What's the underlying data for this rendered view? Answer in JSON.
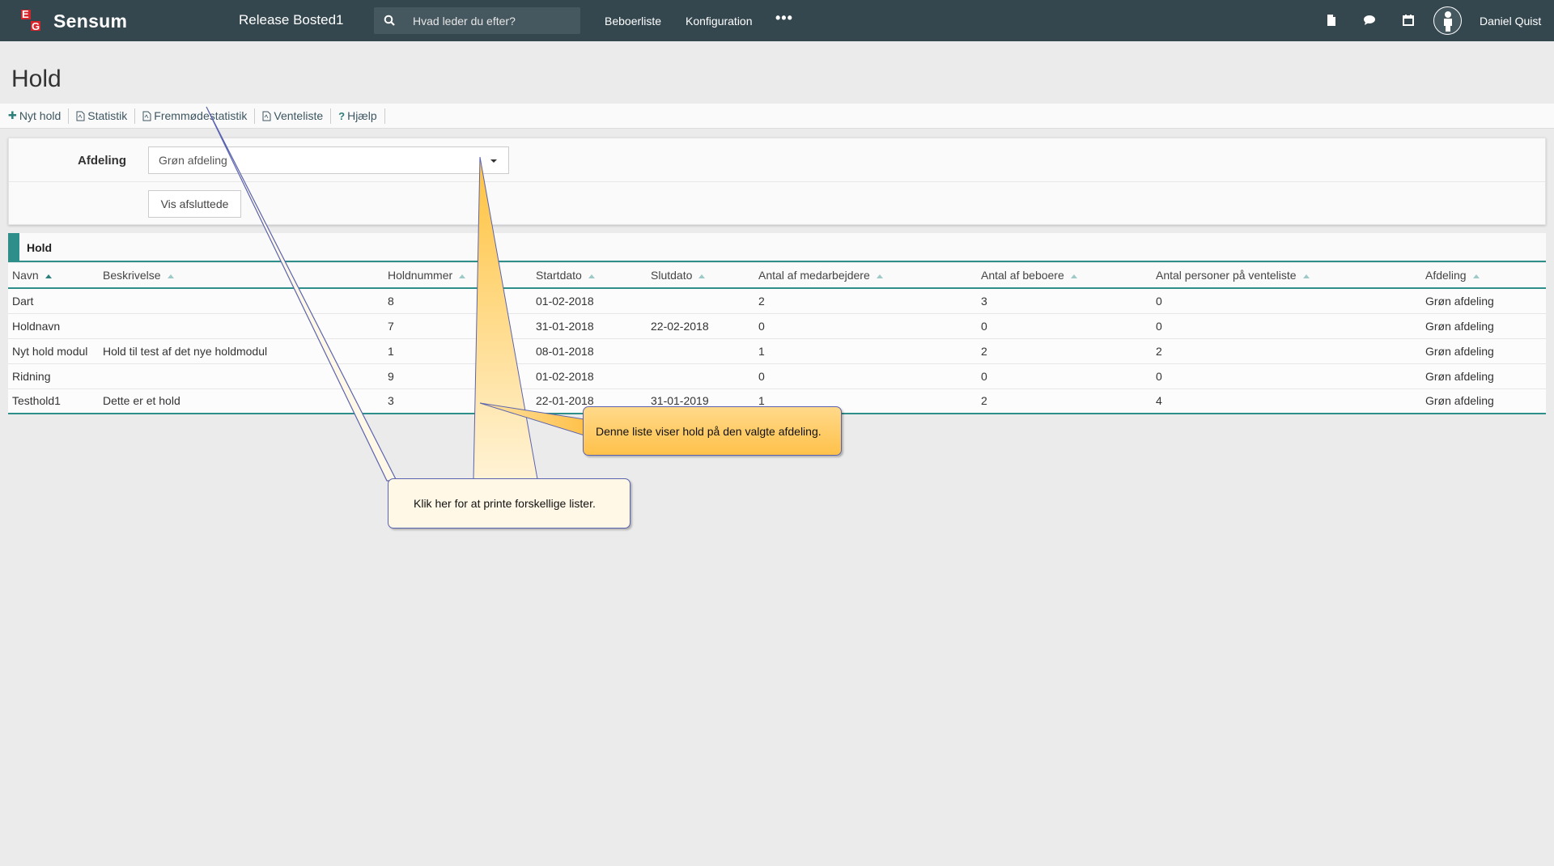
{
  "navbar": {
    "brand_logo_letters": "EG",
    "brand_name": "Sensum",
    "app_title": "Release Bosted1",
    "search_placeholder": "Hvad leder du efter?",
    "links": [
      "Beboerliste",
      "Konfiguration"
    ],
    "more_label": "•••",
    "icons": [
      "document-icon",
      "chat-icon",
      "calendar-icon",
      "person-avatar-icon"
    ],
    "user_name": "Daniel Quist"
  },
  "page": {
    "title": "Hold"
  },
  "toolbar": {
    "items": [
      {
        "icon": "plus-icon",
        "label": "Nyt hold"
      },
      {
        "icon": "pdf-icon",
        "label": "Statistik"
      },
      {
        "icon": "pdf-icon",
        "label": "Fremmødestatistik"
      },
      {
        "icon": "pdf-icon",
        "label": "Venteliste"
      },
      {
        "icon": "question-icon",
        "label": "Hjælp"
      }
    ]
  },
  "filter": {
    "department_label": "Afdeling",
    "department_value": "Grøn afdeling",
    "show_finished_label": "Vis afsluttede"
  },
  "hold_table": {
    "title": "Hold",
    "columns": [
      "Navn",
      "Beskrivelse",
      "Holdnummer",
      "Startdato",
      "Slutdato",
      "Antal af medarbejdere",
      "Antal af beboere",
      "Antal personer på venteliste",
      "Afdeling"
    ],
    "sorted_column": "Navn",
    "rows": [
      [
        "Dart",
        "",
        "8",
        "01-02-2018",
        "",
        "2",
        "3",
        "0",
        "Grøn afdeling"
      ],
      [
        "Holdnavn",
        "",
        "7",
        "31-01-2018",
        "22-02-2018",
        "0",
        "0",
        "0",
        "Grøn afdeling"
      ],
      [
        "Nyt hold modul",
        "Hold til test af det nye holdmodul",
        "1",
        "08-01-2018",
        "",
        "1",
        "2",
        "2",
        "Grøn afdeling"
      ],
      [
        "Ridning",
        "",
        "9",
        "01-02-2018",
        "",
        "0",
        "0",
        "0",
        "Grøn afdeling"
      ],
      [
        "Testhold1",
        "Dette er et hold",
        "3",
        "22-01-2018",
        "31-01-2019",
        "1",
        "2",
        "4",
        "Grøn afdeling"
      ]
    ]
  },
  "callouts": {
    "list_info": "Denne liste viser hold på den valgte afdeling.",
    "print_info": "Klik her for at printe forskellige lister."
  },
  "colors": {
    "navbar_bg": "#34474f",
    "accent_teal": "#2e8e8a",
    "logo_red": "#d7242a",
    "callout_orange": "#ffc14a"
  }
}
